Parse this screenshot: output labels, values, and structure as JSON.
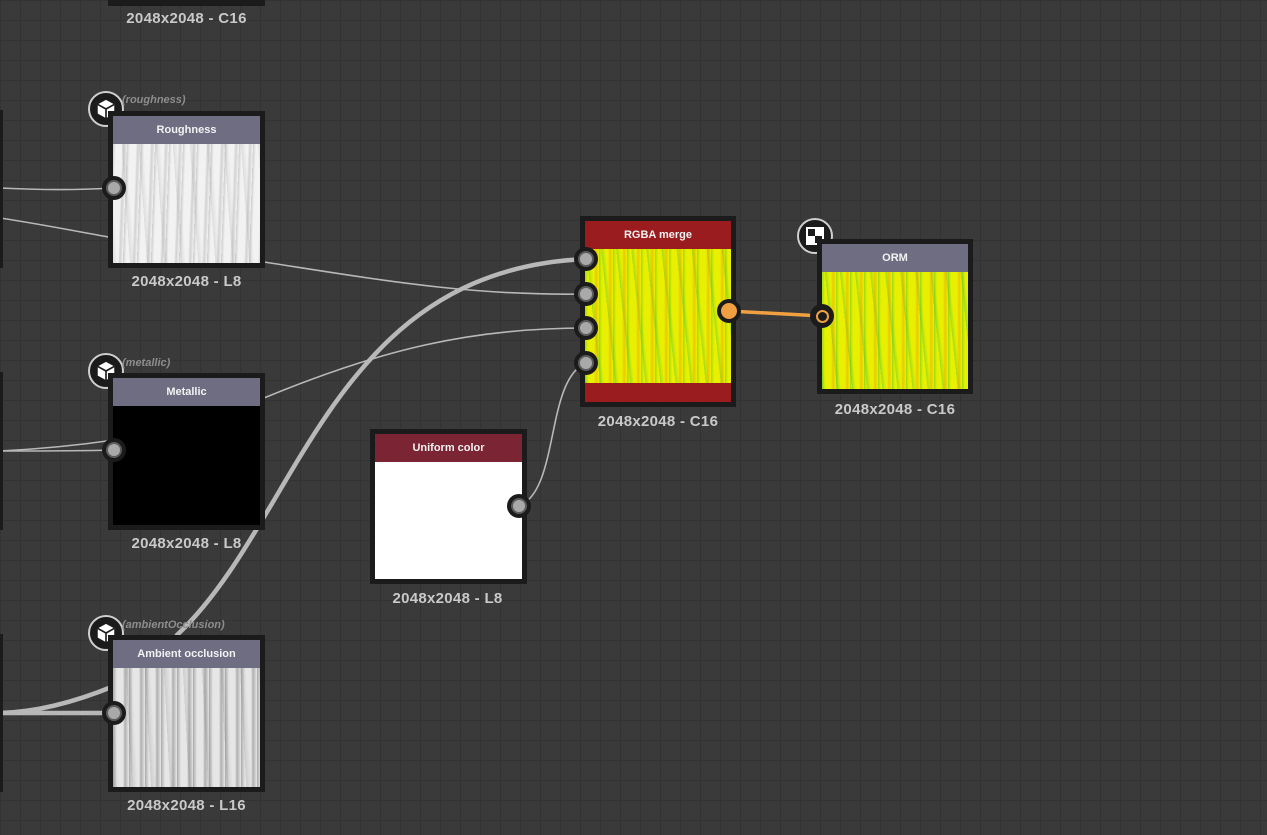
{
  "graph": {
    "top_node": {
      "resolution": "2048x2048 - C16"
    },
    "roughness": {
      "tag": "(roughness)",
      "title": "Roughness",
      "resolution": "2048x2048 - L8",
      "header_color": "#6f6d82"
    },
    "metallic": {
      "tag": "(metallic)",
      "title": "Metallic",
      "resolution": "2048x2048 - L8",
      "header_color": "#6f6d82"
    },
    "ambient_occlusion": {
      "tag": "(ambientOcclusion)",
      "title": "Ambient occlusion",
      "resolution": "2048x2048 - L16",
      "header_color": "#6f6d82"
    },
    "uniform_color": {
      "title": "Uniform color",
      "resolution": "2048x2048 - L8",
      "header_color": "#7b2433"
    },
    "rgba_merge": {
      "title": "RGBA merge",
      "resolution": "2048x2048 - C16",
      "header_color": "#9b1c1f"
    },
    "orm": {
      "title": "ORM",
      "resolution": "2048x2048 - C16",
      "header_color": "#6f6d82"
    }
  },
  "icons": {
    "output_badge": "cube-icon",
    "export_badge": "checker-icon"
  },
  "colors": {
    "canvas": "#3a3a3a",
    "wire": "#b8b8b8",
    "active_wire": "#f0a040"
  }
}
